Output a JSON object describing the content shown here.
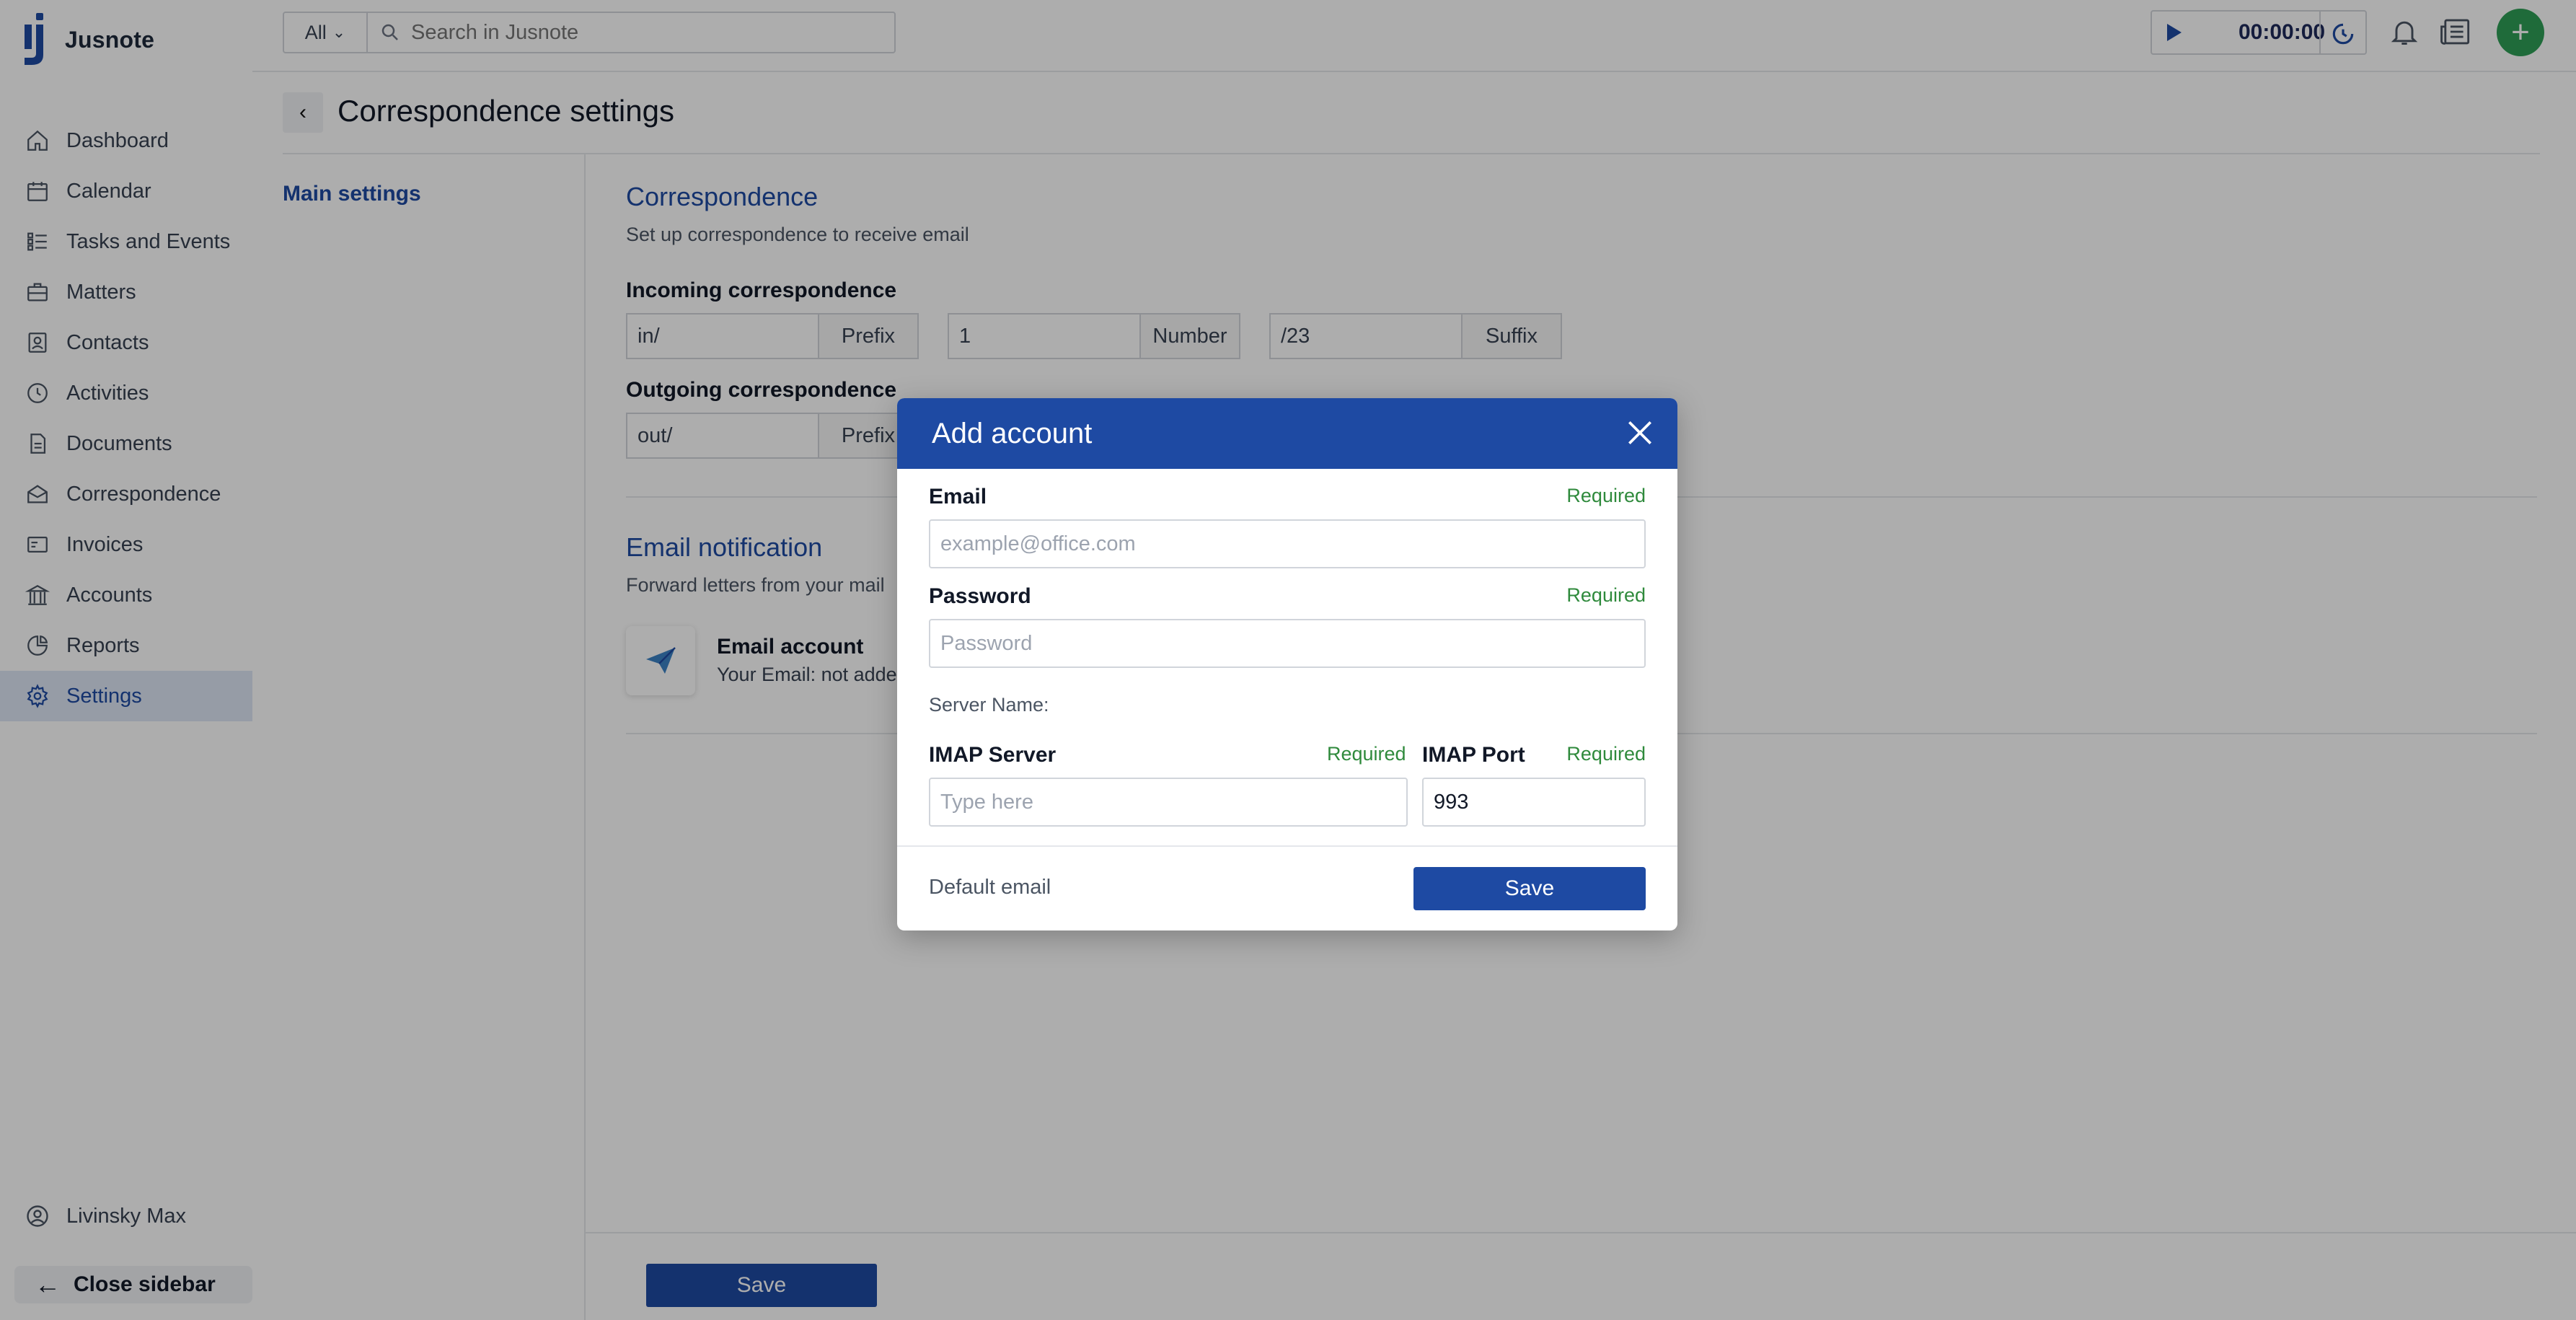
{
  "app": {
    "name": "Jusnote"
  },
  "topbar": {
    "search_scope": "All",
    "search_placeholder": "Search in Jusnote",
    "timer": "00:00:00"
  },
  "sidebar": {
    "items": [
      {
        "label": "Dashboard",
        "icon": "home-icon"
      },
      {
        "label": "Calendar",
        "icon": "calendar-icon"
      },
      {
        "label": "Tasks and Events",
        "icon": "tasks-icon"
      },
      {
        "label": "Matters",
        "icon": "briefcase-icon"
      },
      {
        "label": "Contacts",
        "icon": "contacts-icon"
      },
      {
        "label": "Activities",
        "icon": "clock-icon"
      },
      {
        "label": "Documents",
        "icon": "documents-icon"
      },
      {
        "label": "Correspondence",
        "icon": "mail-icon"
      },
      {
        "label": "Invoices",
        "icon": "invoice-icon"
      },
      {
        "label": "Accounts",
        "icon": "bank-icon"
      },
      {
        "label": "Reports",
        "icon": "chart-icon"
      },
      {
        "label": "Settings",
        "icon": "gear-icon",
        "active": true
      }
    ],
    "user": "Livinsky Max",
    "close_label": "Close sidebar"
  },
  "page": {
    "title": "Correspondence settings",
    "nav_item": "Main settings",
    "section1": {
      "title": "Correspondence",
      "desc": "Set up correspondence to receive email"
    },
    "incoming": {
      "label": "Incoming correspondence",
      "prefix_value": "in/",
      "prefix_tag": "Prefix",
      "number_value": "1",
      "number_tag": "Number",
      "suffix_value": "/23",
      "suffix_tag": "Suffix"
    },
    "outgoing": {
      "label": "Outgoing correspondence",
      "prefix_value": "out/",
      "prefix_tag": "Prefix"
    },
    "section2": {
      "title": "Email notification",
      "desc": "Forward letters from your mail"
    },
    "account": {
      "title": "Email account",
      "sub": "Your Email:  not adde"
    },
    "save_label": "Save"
  },
  "modal": {
    "title": "Add account",
    "email_label": "Email",
    "email_required": "Required",
    "email_placeholder": "example@office.com",
    "password_label": "Password",
    "password_required": "Required",
    "password_placeholder": "Password",
    "server_name_label": "Server Name:",
    "imap_server_label": "IMAP Server",
    "imap_server_required": "Required",
    "imap_server_placeholder": "Type here",
    "imap_port_label": "IMAP Port",
    "imap_port_required": "Required",
    "imap_port_value": "993",
    "default_email": "Default email",
    "save_label": "Save"
  },
  "colors": {
    "brand_blue": "#1e4aa3",
    "required_green": "#2f8a3c",
    "add_green": "#2f9e56"
  }
}
